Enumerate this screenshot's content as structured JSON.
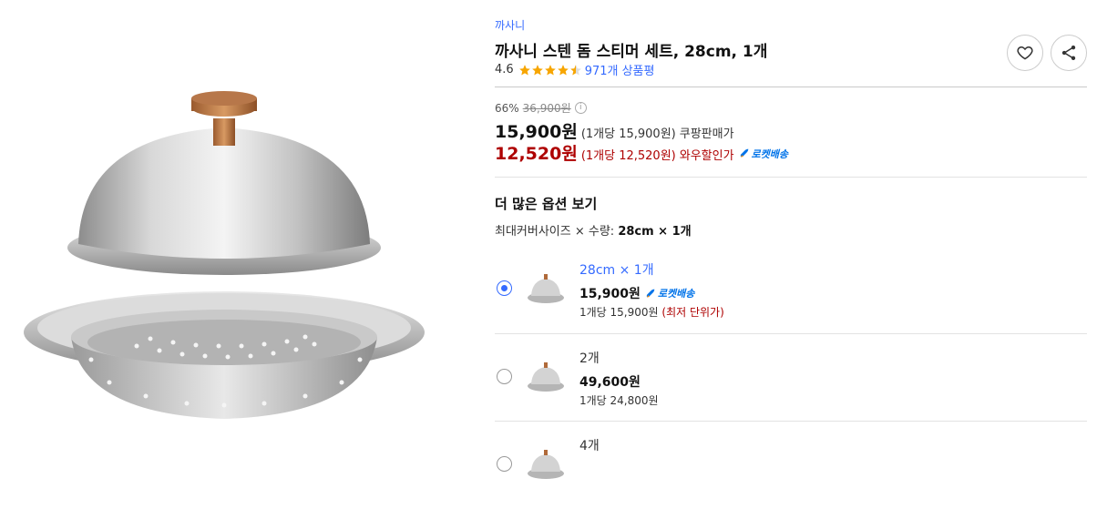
{
  "product": {
    "brand": "까사니",
    "title": "까사니 스텐 돔 스티머 세트, 28cm, 1개",
    "rating": "4.6",
    "stars_filled": 4.5,
    "reviews": "971개 상품평"
  },
  "pricing": {
    "discount_pct": "66%",
    "original_price": "36,900원",
    "sale_price": "15,900원",
    "sale_unit": "(1개당 15,900원)",
    "sale_tag": "쿠팡판매가",
    "wow_price": "12,520원",
    "wow_unit": "(1개당 12,520원)",
    "wow_tag": "와우할인가",
    "rocket_label": "로켓배송"
  },
  "options": {
    "section_title": "더 많은 옵션 보기",
    "summary_prefix": "최대커버사이즈 × 수량: ",
    "summary_value": "28cm × 1개",
    "items": [
      {
        "name": "28cm × 1개",
        "price": "15,900원",
        "rocket": "로켓배송",
        "unit": "1개당 15,900원",
        "note": "(최저 단위가)",
        "selected": true
      },
      {
        "name": "2개",
        "price": "49,600원",
        "unit": "1개당 24,800원",
        "selected": false
      },
      {
        "name": "4개",
        "selected": false
      }
    ]
  },
  "colors": {
    "brand_blue": "#346aff",
    "wow_red": "#ae0000",
    "rocket_blue": "#0073e9",
    "star": "#f7a500"
  }
}
